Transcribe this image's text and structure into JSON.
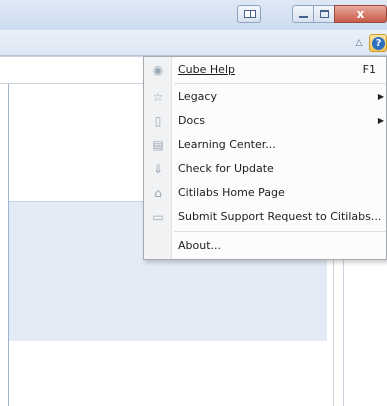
{
  "menu": {
    "items": [
      {
        "label": "Cube Help",
        "shortcut": "F1",
        "icon": "help-circle-icon",
        "glyph": "◉"
      },
      {
        "label": "Legacy",
        "icon": "star-icon",
        "glyph": "☆",
        "submenu": true
      },
      {
        "label": "Docs",
        "icon": "document-icon",
        "glyph": "▯",
        "submenu": true
      },
      {
        "label": "Learning Center...",
        "icon": "film-strip-icon",
        "glyph": "▤"
      },
      {
        "label": "Check for Update",
        "icon": "download-arrow-icon",
        "glyph": "⇓"
      },
      {
        "label": "Citilabs Home Page",
        "icon": "home-icon",
        "glyph": "⌂"
      },
      {
        "label": "Submit Support Request to Citilabs...",
        "icon": "speech-bubble-icon",
        "glyph": "▭"
      },
      {
        "label": "About..."
      }
    ],
    "submenu_arrow": "▶"
  },
  "titlebar": {
    "close_glyph": "x"
  },
  "ribbon": {
    "collapse_glyph": "△",
    "help_glyph": "?"
  },
  "colors": {
    "help_accent": "#2f6fc0",
    "close_red": "#c75a48",
    "selection": "#e3ebf6"
  }
}
